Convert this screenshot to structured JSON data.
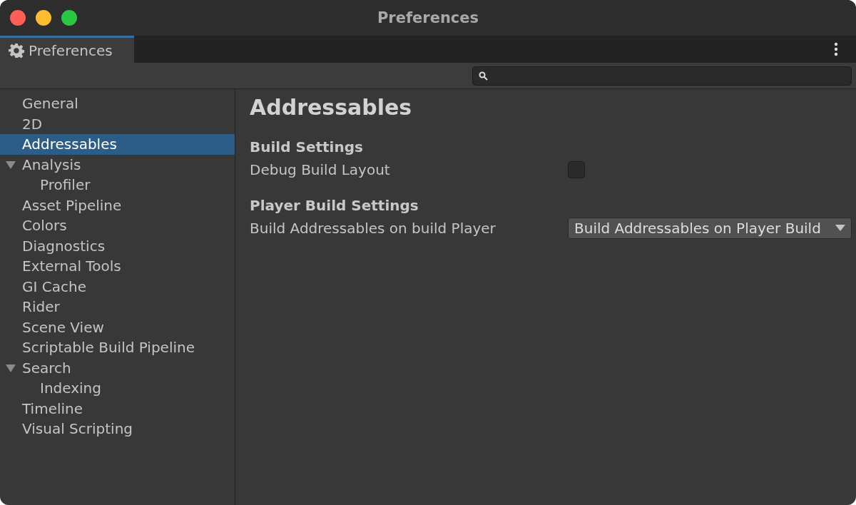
{
  "window": {
    "title": "Preferences"
  },
  "tabs": [
    {
      "label": "Preferences",
      "selected": true
    }
  ],
  "sidebar": {
    "items": [
      {
        "label": "General",
        "selected": false
      },
      {
        "label": "2D",
        "selected": false
      },
      {
        "label": "Addressables",
        "selected": true
      },
      {
        "label": "Analysis",
        "selected": false,
        "expanded": true,
        "children": [
          {
            "label": "Profiler",
            "selected": false
          }
        ]
      },
      {
        "label": "Asset Pipeline",
        "selected": false
      },
      {
        "label": "Colors",
        "selected": false
      },
      {
        "label": "Diagnostics",
        "selected": false
      },
      {
        "label": "External Tools",
        "selected": false
      },
      {
        "label": "GI Cache",
        "selected": false
      },
      {
        "label": "Rider",
        "selected": false
      },
      {
        "label": "Scene View",
        "selected": false
      },
      {
        "label": "Scriptable Build Pipeline",
        "selected": false
      },
      {
        "label": "Search",
        "selected": false,
        "expanded": true,
        "children": [
          {
            "label": "Indexing",
            "selected": false
          }
        ]
      },
      {
        "label": "Timeline",
        "selected": false
      },
      {
        "label": "Visual Scripting",
        "selected": false
      }
    ]
  },
  "content": {
    "title": "Addressables",
    "sections": [
      {
        "heading": "Build Settings",
        "fields": [
          {
            "kind": "checkbox",
            "label": "Debug Build Layout",
            "checked": false
          }
        ]
      },
      {
        "heading": "Player Build Settings",
        "fields": [
          {
            "kind": "dropdown",
            "label": "Build Addressables on build Player",
            "value": "Build Addressables on Player Build"
          }
        ]
      }
    ]
  }
}
